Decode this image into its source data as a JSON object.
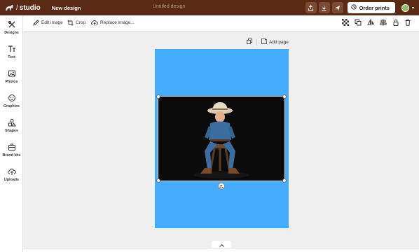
{
  "header": {
    "logo_text": "studio",
    "new_design_label": "New design",
    "document_title": "Untitled design",
    "order_prints_label": "Order prints"
  },
  "sidebar": {
    "items": [
      {
        "label": "Designs",
        "icon": "designs-icon"
      },
      {
        "label": "Text",
        "icon": "text-icon"
      },
      {
        "label": "Photos",
        "icon": "photos-icon"
      },
      {
        "label": "Graphics",
        "icon": "graphics-icon"
      },
      {
        "label": "Shapes",
        "icon": "shapes-icon"
      },
      {
        "label": "Brand kits",
        "icon": "briefcase-icon"
      },
      {
        "label": "Uploads",
        "icon": "upload-cloud-icon"
      }
    ]
  },
  "toolbar": {
    "edit_image_label": "Edit image",
    "crop_label": "Crop",
    "replace_image_label": "Replace image..."
  },
  "canvas": {
    "add_page_label": "Add page",
    "page_color": "#45adff"
  },
  "colors": {
    "header_bg": "#5a2a14",
    "accent_blue": "#45adff"
  }
}
